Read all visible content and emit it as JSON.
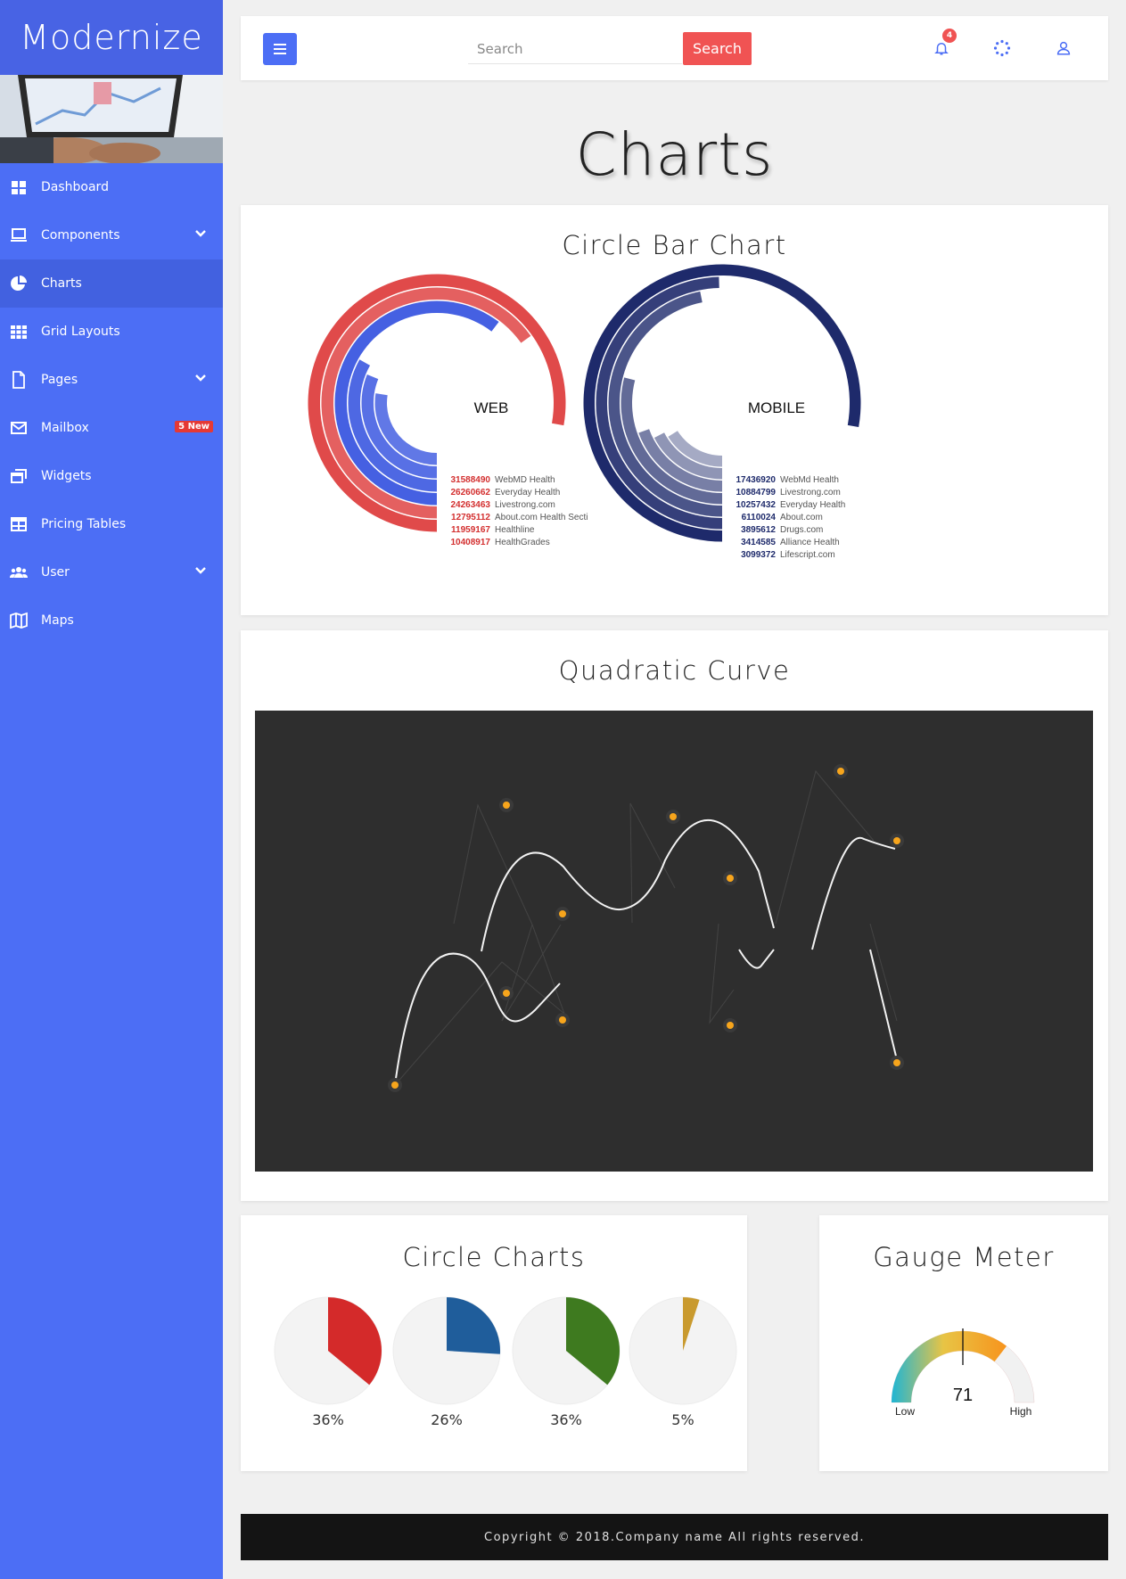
{
  "brand": {
    "name": "Modernize"
  },
  "sidebar": {
    "items": [
      {
        "label": "Dashboard",
        "icon": "dashboard-icon",
        "has_submenu": false,
        "active": false
      },
      {
        "label": "Components",
        "icon": "laptop-icon",
        "has_submenu": true,
        "active": false
      },
      {
        "label": "Charts",
        "icon": "pie-chart-icon",
        "has_submenu": false,
        "active": true
      },
      {
        "label": "Grid Layouts",
        "icon": "grid-icon",
        "has_submenu": false,
        "active": false
      },
      {
        "label": "Pages",
        "icon": "file-icon",
        "has_submenu": true,
        "active": false
      },
      {
        "label": "Mailbox",
        "icon": "envelope-icon",
        "has_submenu": false,
        "active": false,
        "badge": "5 New"
      },
      {
        "label": "Widgets",
        "icon": "window-restore-icon",
        "has_submenu": false,
        "active": false
      },
      {
        "label": "Pricing Tables",
        "icon": "table-icon",
        "has_submenu": false,
        "active": false
      },
      {
        "label": "User",
        "icon": "users-icon",
        "has_submenu": true,
        "active": false
      },
      {
        "label": "Maps",
        "icon": "map-icon",
        "has_submenu": false,
        "active": false
      }
    ]
  },
  "topbar": {
    "search_placeholder": "Search",
    "search_button": "Search",
    "notification_count": "4"
  },
  "page": {
    "title": "Charts"
  },
  "sections": {
    "circle_bar_title": "Circle Bar Chart",
    "quadratic_title": "Quadratic Curve",
    "circle_charts_title": "Circle Charts",
    "gauge_title": "Gauge Meter"
  },
  "chart_data": [
    {
      "type": "radial-bar",
      "center_label": "WEB",
      "color": "#e04a4a",
      "categories": [
        "WebMD Health",
        "Everyday Health",
        "Livestrong.com",
        "About.com Health Secti",
        "Healthline",
        "HealthGrades"
      ],
      "values": [
        31588490,
        26260662,
        24263463,
        12795112,
        11959167,
        10408917
      ]
    },
    {
      "type": "radial-bar",
      "center_label": "MOBILE",
      "color": "#1e2a6b",
      "categories": [
        "WebMd Health",
        "Livestrong.com",
        "Everyday Health",
        "About.com",
        "Drugs.com",
        "Alliance Health",
        "Lifescript.com"
      ],
      "values": [
        17436920,
        10884799,
        10257432,
        6110024,
        3895612,
        3414585,
        3099372
      ]
    },
    {
      "type": "pie",
      "items": [
        {
          "label": "36%",
          "value": 36,
          "color": "#d42a2a"
        },
        {
          "label": "26%",
          "value": 26,
          "color": "#1f5d9b"
        },
        {
          "label": "36%",
          "value": 36,
          "color": "#3e7a1f"
        },
        {
          "label": "5%",
          "value": 5,
          "color": "#c99a2e"
        }
      ]
    },
    {
      "type": "gauge",
      "value": 71,
      "value_label": "71",
      "min_label": "Low",
      "max_label": "High"
    }
  ],
  "footer": {
    "text": "Copyright © 2018.Company name All rights reserved."
  }
}
